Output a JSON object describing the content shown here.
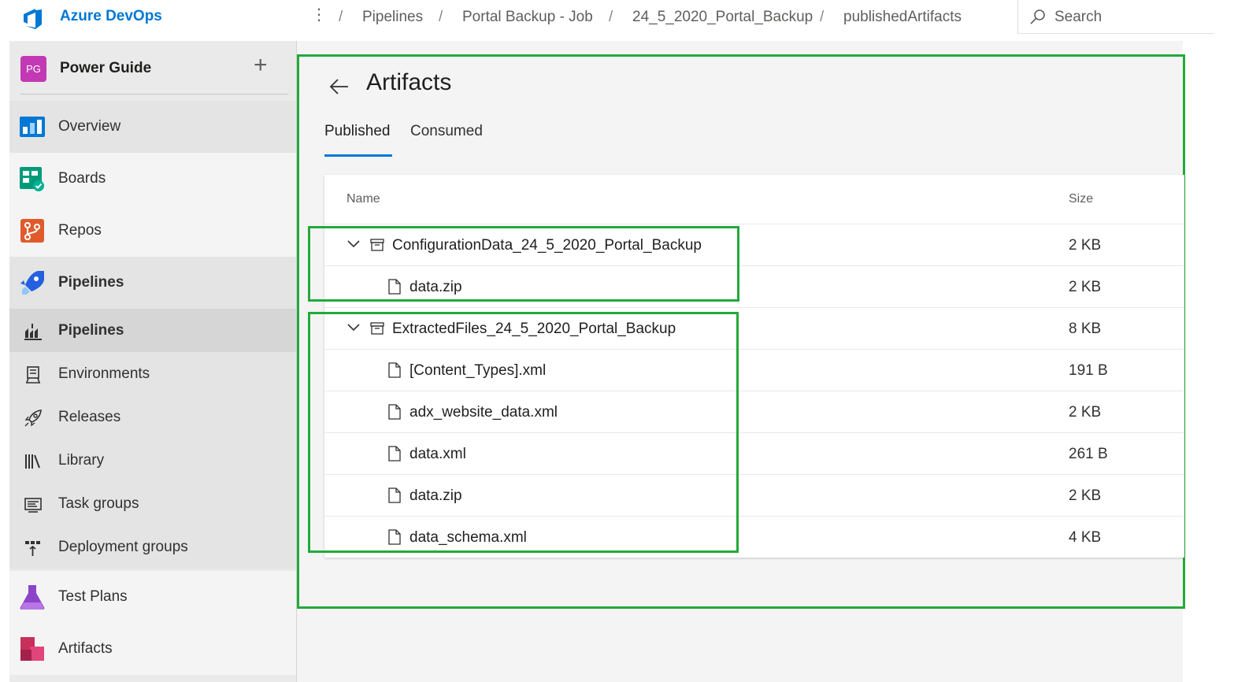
{
  "brand": {
    "name": "Azure DevOps",
    "accent": "#0078d4",
    "logo_icon": "azure-devops-logo-icon"
  },
  "breadcrumb": {
    "more": "⋮",
    "separator": "/",
    "items": [
      "Pipelines",
      "Portal Backup - Job",
      "24_5_2020_Portal_Backup",
      "publishedArtifacts"
    ]
  },
  "search": {
    "placeholder": "Search",
    "value": ""
  },
  "sidebar": {
    "project": {
      "initials": "PG",
      "name": "Power Guide",
      "add_icon": "plus-icon",
      "avatar_color": "#c239b3"
    },
    "items": [
      {
        "label": "Overview",
        "icon": "overview-icon"
      },
      {
        "label": "Boards",
        "icon": "boards-icon"
      },
      {
        "label": "Repos",
        "icon": "repos-icon"
      },
      {
        "label": "Pipelines",
        "icon": "pipelines-icon"
      },
      {
        "label": "Pipelines",
        "icon": "pipelines-sub-icon"
      },
      {
        "label": "Environments",
        "icon": "environments-icon"
      },
      {
        "label": "Releases",
        "icon": "releases-icon"
      },
      {
        "label": "Library",
        "icon": "library-icon"
      },
      {
        "label": "Task groups",
        "icon": "task-groups-icon"
      },
      {
        "label": "Deployment groups",
        "icon": "deployment-groups-icon"
      },
      {
        "label": "Test Plans",
        "icon": "test-plans-icon"
      },
      {
        "label": "Artifacts",
        "icon": "artifacts-icon"
      }
    ]
  },
  "main": {
    "title": "Artifacts",
    "back_icon": "back-arrow-icon",
    "tabs": [
      {
        "label": "Published",
        "selected": true
      },
      {
        "label": "Consumed",
        "selected": false
      }
    ],
    "table": {
      "headers": {
        "name": "Name",
        "size": "Size"
      },
      "rows": [
        {
          "name": "ConfigurationData_24_5_2020_Portal_Backup",
          "size": "2 KB",
          "type": "artifact",
          "expanded": true
        },
        {
          "name": "data.zip",
          "size": "2 KB",
          "type": "file"
        },
        {
          "name": "ExtractedFiles_24_5_2020_Portal_Backup",
          "size": "8 KB",
          "type": "artifact",
          "expanded": true
        },
        {
          "name": "[Content_Types].xml",
          "size": "191 B",
          "type": "file"
        },
        {
          "name": "adx_website_data.xml",
          "size": "2 KB",
          "type": "file"
        },
        {
          "name": "data.xml",
          "size": "261 B",
          "type": "file"
        },
        {
          "name": "data.zip",
          "size": "2 KB",
          "type": "file"
        },
        {
          "name": "data_schema.xml",
          "size": "4 KB",
          "type": "file"
        }
      ]
    }
  },
  "colors": {
    "highlight": "#22aa3a",
    "tab_underline": "#0078d4"
  }
}
